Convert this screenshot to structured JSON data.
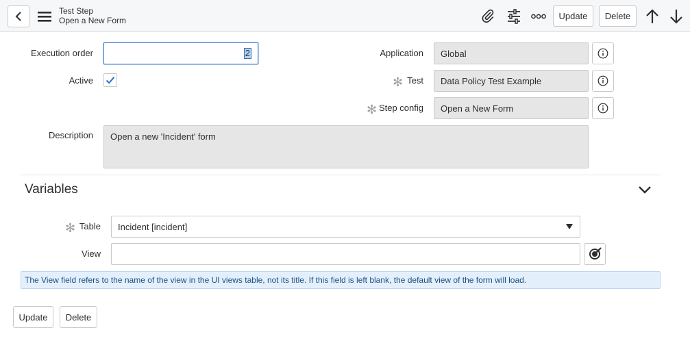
{
  "header": {
    "back_icon": "chevron-left-icon",
    "menu_icon": "hamburger-icon",
    "title_line1": "Test Step",
    "title_line2": "Open a New Form",
    "attachment_icon": "paperclip-icon",
    "personalize_icon": "sliders-icon",
    "more_icon": "more-options-icon",
    "update_label": "Update",
    "delete_label": "Delete",
    "prev_icon": "arrow-up-icon",
    "next_icon": "arrow-down-icon"
  },
  "form": {
    "execution_order": {
      "label": "Execution order",
      "value": "2"
    },
    "active": {
      "label": "Active",
      "checked": true
    },
    "description": {
      "label": "Description",
      "value": "Open a new 'Incident' form"
    },
    "application": {
      "label": "Application",
      "value": "Global"
    },
    "test": {
      "label": "Test",
      "value": "Data Policy Test Example"
    },
    "step_config": {
      "label": "Step config",
      "value": "Open a New Form"
    }
  },
  "variables": {
    "title": "Variables",
    "table": {
      "label": "Table",
      "value": "Incident [incident]"
    },
    "view": {
      "label": "View",
      "value": ""
    },
    "info": "The View field refers to the name of the view in the UI views table, not its title. If this field is left blank, the default view of the form will load."
  },
  "footer": {
    "update_label": "Update",
    "delete_label": "Delete"
  },
  "colors": {
    "header_bg": "#f6f7f8",
    "readonly_bg": "#e6e6e6",
    "focus_border": "#5a8fd1",
    "info_bg": "#e3f0fc",
    "info_text": "#1e4f80"
  }
}
